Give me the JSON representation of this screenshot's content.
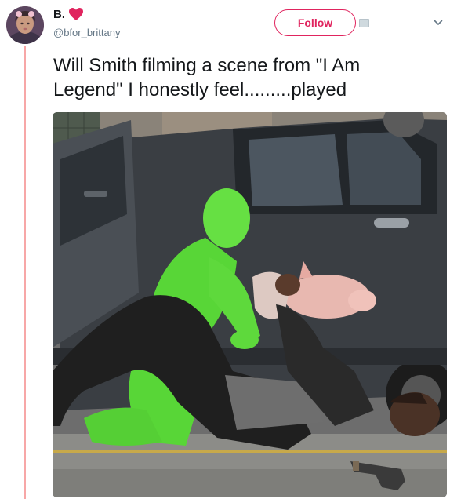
{
  "tweet": {
    "display_name": "B.",
    "handle": "@bfor_brittany",
    "text": "Will Smith filming a scene from \"I Am Legend\" I honestly feel.........played",
    "follow_label": "Follow",
    "icons": {
      "name_badge": "heart-icon",
      "menu": "chevron-down-icon"
    },
    "colors": {
      "accent": "#e0245e",
      "heart": "#e0245e",
      "thread_line": "#f7a7a7"
    }
  }
}
